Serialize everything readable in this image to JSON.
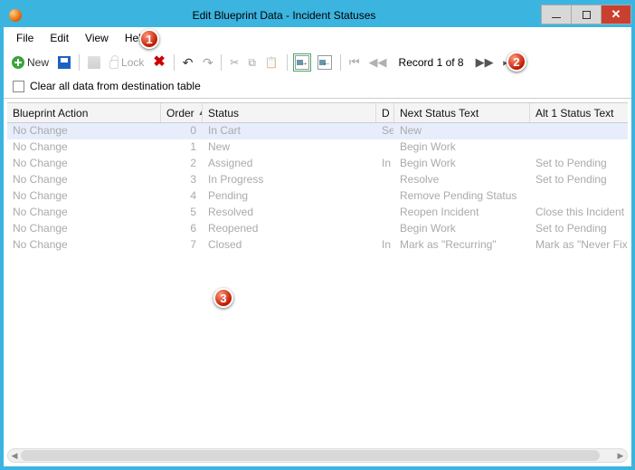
{
  "window": {
    "title": "Edit Blueprint Data - Incident Statuses"
  },
  "menu": {
    "file": "File",
    "edit": "Edit",
    "view": "View",
    "help": "Help"
  },
  "toolbar": {
    "new_label": "New",
    "lock_label": "Lock",
    "record_text": "Record 1 of 8"
  },
  "checkbox": {
    "clear_label": "Clear all data from destination table"
  },
  "columns": {
    "action": "Blueprint Action",
    "order": "Order",
    "status": "Status",
    "disp": "D",
    "next": "Next Status Text",
    "alt": "Alt 1 Status Text"
  },
  "rows": [
    {
      "action": "No Change",
      "order": "0",
      "status": "In Cart",
      "disp": "Se",
      "next": "New",
      "alt": ""
    },
    {
      "action": "No Change",
      "order": "1",
      "status": "New",
      "disp": "",
      "next": "Begin Work",
      "alt": ""
    },
    {
      "action": "No Change",
      "order": "2",
      "status": "Assigned",
      "disp": "In",
      "next": "Begin Work",
      "alt": "Set to Pending"
    },
    {
      "action": "No Change",
      "order": "3",
      "status": "In Progress",
      "disp": "",
      "next": "Resolve",
      "alt": "Set to Pending"
    },
    {
      "action": "No Change",
      "order": "4",
      "status": "Pending",
      "disp": "",
      "next": "Remove Pending Status",
      "alt": ""
    },
    {
      "action": "No Change",
      "order": "5",
      "status": "Resolved",
      "disp": "",
      "next": "Reopen Incident",
      "alt": "Close this Incident"
    },
    {
      "action": "No Change",
      "order": "6",
      "status": "Reopened",
      "disp": "",
      "next": "Begin Work",
      "alt": "Set to Pending"
    },
    {
      "action": "No Change",
      "order": "7",
      "status": "Closed",
      "disp": "In",
      "next": "Mark as \"Recurring\"",
      "alt": "Mark as \"Never Fixed\""
    }
  ],
  "callouts": {
    "one": "1",
    "two": "2",
    "three": "3"
  }
}
